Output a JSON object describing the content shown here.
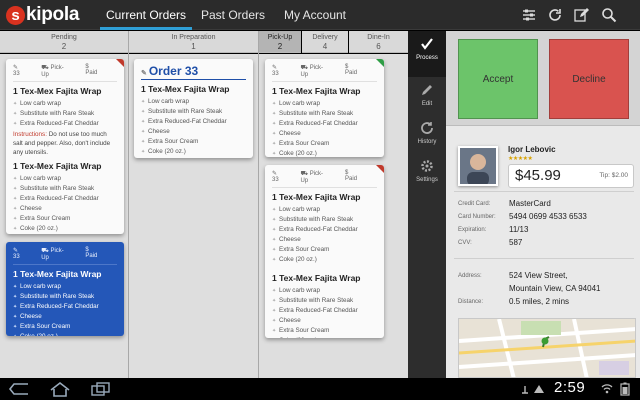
{
  "app": {
    "logo_mark": "s",
    "logo_text": "kipola"
  },
  "nav": {
    "tabs": [
      "Current Orders",
      "Past Orders",
      "My Account"
    ],
    "active_tab": 0
  },
  "columns": [
    {
      "label": "Pending",
      "count": "2"
    },
    {
      "label": "In Preparation",
      "count": "1"
    },
    {
      "label": "Pick-Up",
      "count": "2"
    },
    {
      "label": "Delivery",
      "count": "4"
    },
    {
      "label": "Dine-In",
      "count": "6"
    }
  ],
  "meta": {
    "order_number": "33",
    "method": "Pick-Up",
    "payment": "Paid"
  },
  "item": {
    "title": "1 Tex-Mex Fajita Wrap",
    "mods": [
      "Low carb wrap",
      "Substitute with Rare Steak",
      "Extra Reduced-Fat Cheddar",
      "Cheese",
      "Extra Sour Cream",
      "Coke (20 oz.)"
    ]
  },
  "instructions": {
    "label": "Instructions:",
    "text": " Do not use too much salt and pepper. Also, don't include any utensils."
  },
  "order_big_title": "Order 33",
  "sidebar": [
    "Process",
    "Edit",
    "History",
    "Settings"
  ],
  "actions": {
    "accept": "Accept",
    "decline": "Decline"
  },
  "customer": {
    "name": "Igor Lebovic",
    "stars": "★★★★★",
    "amount": "$45.99",
    "tip": "Tip: $2.00"
  },
  "details": {
    "credit_card_label": "Credit Card:",
    "credit_card": "MasterCard",
    "card_number_label": "Card Number:",
    "card_number": "5494 0699 4533 6533",
    "expiration_label": "Expiration:",
    "expiration": "11/13",
    "cvv_label": "CVV:",
    "cvv": "587",
    "address_label": "Address:",
    "address_line1": "524 View Street,",
    "address_line2": "Mountain View, CA 94041",
    "distance_label": "Distance:",
    "distance": "0.5 miles, 2 mins"
  },
  "clock": "2:59",
  "colors": {
    "accent": "#2f9fd6",
    "accept": "#6cc46a",
    "decline": "#d9534f",
    "selected_order": "#2457b8",
    "brand": "#d9321f"
  }
}
